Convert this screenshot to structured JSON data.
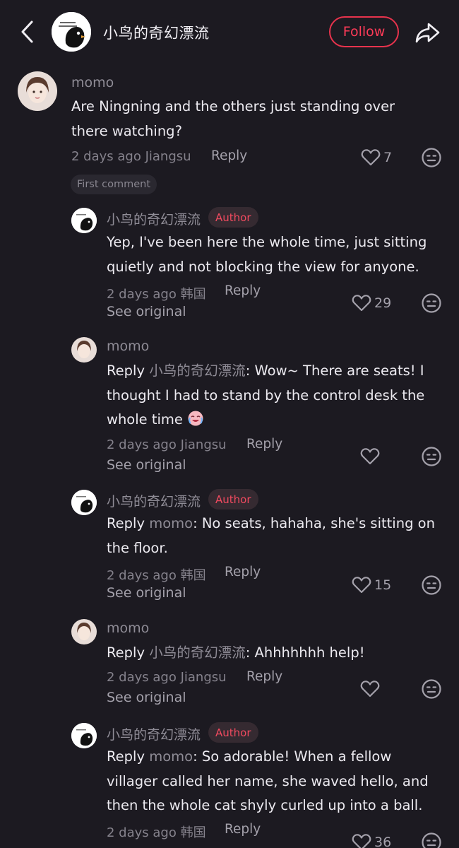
{
  "header": {
    "title": "小鸟的奇幻漂流",
    "follow_label": "Follow"
  },
  "comments": [
    {
      "author": "momo",
      "text": "Are Ningning and the others just standing over there watching?",
      "time": "2 days ago",
      "location": "Jiangsu",
      "reply_label": "Reply",
      "likes": "7",
      "first_comment_label": "First comment"
    }
  ],
  "replies": [
    {
      "author": "小鸟的奇幻漂流",
      "badge": "Author",
      "text": "Yep, I've been here the whole time, just sitting quietly and not blocking the view for anyone.",
      "time": "2 days ago",
      "location": "韩国",
      "reply_label": "Reply",
      "see_original": "See original",
      "likes": "29"
    },
    {
      "author": "momo",
      "reply_prefix": "Reply",
      "reply_target": "小鸟的奇幻漂流",
      "text": ": Wow~ There are seats! I thought I had to stand by the control desk the whole time",
      "time": "2 days ago",
      "location": "Jiangsu",
      "reply_label": "Reply",
      "see_original": "See original"
    },
    {
      "author": "小鸟的奇幻漂流",
      "badge": "Author",
      "reply_prefix": "Reply",
      "reply_target": "momo",
      "text": ": No seats, hahaha, she's sitting on the floor.",
      "time": "2 days ago",
      "location": "韩国",
      "reply_label": "Reply",
      "see_original": "See original",
      "likes": "15"
    },
    {
      "author": "momo",
      "reply_prefix": "Reply",
      "reply_target": "小鸟的奇幻漂流",
      "text": ": Ahhhhhhh help!",
      "time": "2 days ago",
      "location": "Jiangsu",
      "reply_label": "Reply",
      "see_original": "See original"
    },
    {
      "author": "小鸟的奇幻漂流",
      "badge": "Author",
      "reply_prefix": "Reply",
      "reply_target": "momo",
      "text": ": So adorable! When a fellow villager called her name, she waved hello, and then the whole cat shyly curled up into a ball.",
      "time": "2 days ago",
      "location": "韩国",
      "reply_label": "Reply",
      "likes": "36"
    }
  ],
  "icons": {
    "back": "chevron-left-icon",
    "share": "share-arrow-icon",
    "like": "heart-outline-icon",
    "dislike": "neutral-face-icon",
    "emoji": "crying-laughing-emoji"
  },
  "colors": {
    "background": "#1c1a21",
    "accent": "#ff3b58",
    "muted_text": "#8f8c96"
  }
}
